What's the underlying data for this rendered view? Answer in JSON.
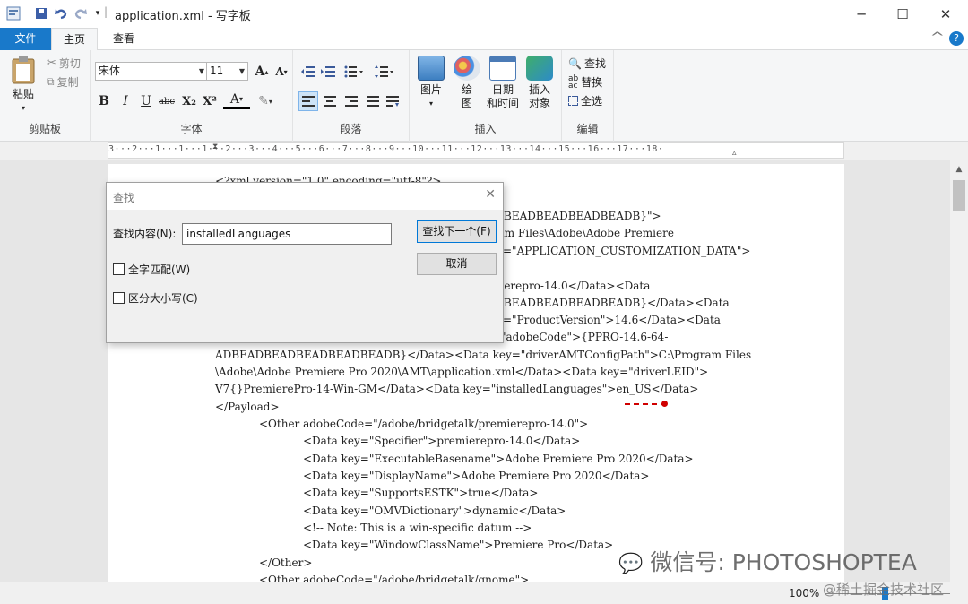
{
  "window": {
    "title": "application.xml - 写字板",
    "controls": {
      "minimize": "─",
      "maximize": "☐",
      "close": "✕"
    },
    "qat_separator": "|"
  },
  "ribbon": {
    "tabs": [
      {
        "label": "文件"
      },
      {
        "label": "主页"
      },
      {
        "label": "查看"
      }
    ],
    "clipboard": {
      "paste": "粘贴",
      "cut": "剪切",
      "copy": "复制",
      "group": "剪贴板"
    },
    "font": {
      "name": "宋体",
      "size": "11",
      "group": "字体",
      "grow": "A",
      "shrink": "A",
      "bold": "B",
      "italic": "I",
      "underline": "U",
      "strike": "abc",
      "subscript": "X₂",
      "superscript": "X²",
      "color": "A",
      "highlight": "✎"
    },
    "paragraph": {
      "group": "段落"
    },
    "insert": {
      "picture": "图片",
      "paint_line1": "绘",
      "paint_line2": "图",
      "datetime_line1": "日期",
      "datetime_line2": "和时间",
      "object_line1": "插入",
      "object_line2": "对象",
      "group": "插入"
    },
    "editing": {
      "find": "查找",
      "replace": "替换",
      "select_all": "全选",
      "group": "编辑"
    },
    "help": "?",
    "collapse": "^"
  },
  "ruler": {
    "ticks": "3···2···1···1···1···2···3···4···5···6···7···8···9···10···11···12···13···14···15···16···17···18·"
  },
  "document": {
    "lines": [
      "<?xml version=\"1.0\" encoding=\"utf-8\"?>",
      "EADBEADBEADBEADBEADB}\">",
      "ogram Files\\Adobe\\Adobe Premiere",
      "=\"APPLICATION_CUSTOMIZATION_DATA\">",
      "emierepro-14.0</Data><Data",
      "EADBEADBEADBEADBEADB}</Data><Data",
      "=\"ProductVersion\">14.6</Data><Data",
      "\"adobeCode\">{PPRO-14.6-64-",
      "ADBEADBEADBEADBEADBEADB}</Data><Data key=\"driverAMTConfigPath\">C:\\Program Files",
      "\\Adobe\\Adobe Premiere Pro 2020\\AMT\\application.xml</Data><Data key=\"driverLEID\">",
      "V7{}PremierePro-14-Win-GM</Data><Data key=\"installedLanguages\">en_US</Data>",
      "</Payload>",
      "<Other adobeCode=\"/adobe/bridgetalk/premierepro-14.0\">",
      "<Data key=\"Specifier\">premierepro-14.0</Data>",
      "<Data key=\"ExecutableBasename\">Adobe Premiere Pro 2020</Data>",
      "<Data key=\"DisplayName\">Adobe Premiere Pro 2020</Data>",
      "<Data key=\"SupportsESTK\">true</Data>",
      "<Data key=\"OMVDictionary\">dynamic</Data>",
      "<!-- Note: This is a win-specific datum -->",
      "<Data key=\"WindowClassName\">Premiere Pro</Data>",
      "</Other>",
      "<Other adobeCode=\"/adobe/bridgetalk/gnome\">"
    ]
  },
  "find_dialog": {
    "title": "查找",
    "close": "✕",
    "label": "查找内容(N):",
    "value": "installedLanguages",
    "find_next": "查找下一个(F)",
    "cancel": "取消",
    "whole_word": "全字匹配(W)",
    "match_case": "区分大小写(C)"
  },
  "statusbar": {
    "zoom": "100%"
  },
  "watermarks": {
    "wechat": "微信号: PHOTOSHOPTEA",
    "juejin": "@稀土掘金技术社区"
  },
  "colors": {
    "accent": "#1979ca",
    "annotation": "#d00000"
  }
}
